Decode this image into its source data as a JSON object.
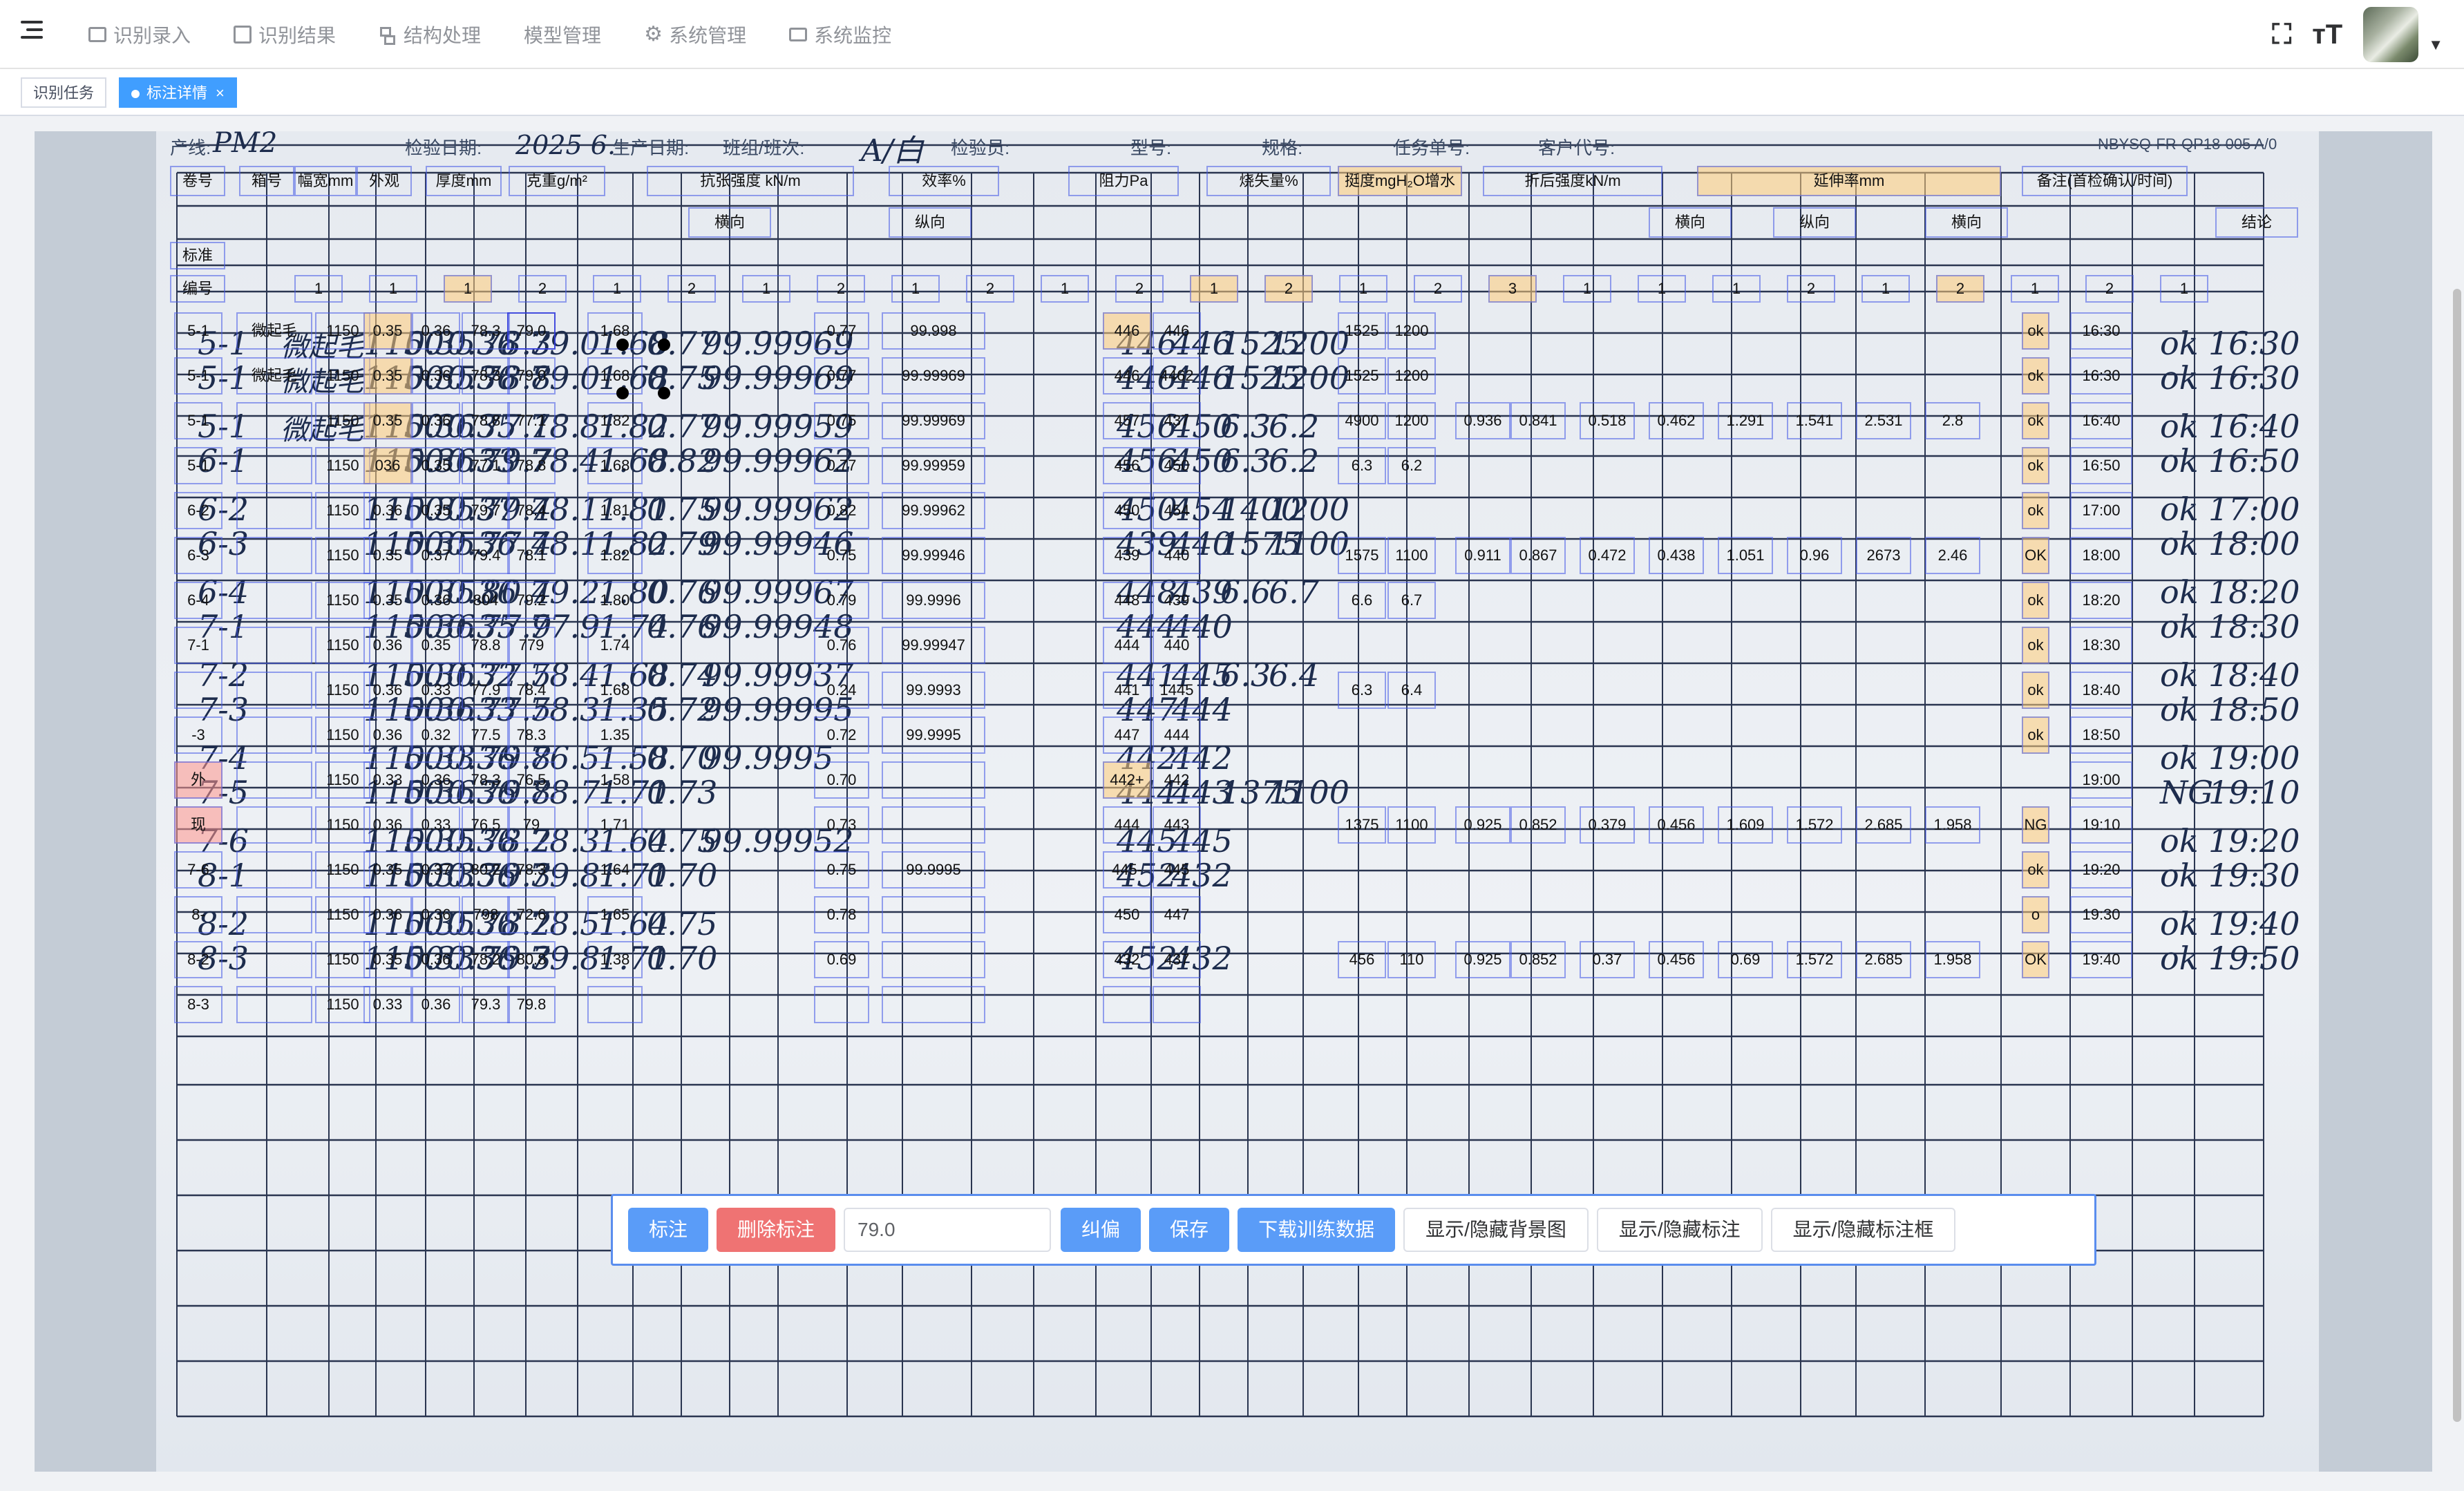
{
  "nav": {
    "menu": [
      {
        "label": "识别录入",
        "icon": "id-card-icon"
      },
      {
        "label": "识别结果",
        "icon": "edit-icon"
      },
      {
        "label": "结构处理",
        "icon": "tree-icon"
      },
      {
        "label": "模型管理",
        "icon": ""
      },
      {
        "label": "系统管理",
        "icon": "gear-icon"
      },
      {
        "label": "系统监控",
        "icon": "monitor-icon"
      }
    ]
  },
  "tags": {
    "task": "识别任务",
    "detail": "标注详情",
    "close": "×"
  },
  "document": {
    "header_fields": {
      "line_label": "产线:",
      "line_value": "PM2",
      "date_label": "检验日期:",
      "date_value": "2025 6.",
      "prod_date_label": "生产日期:",
      "shift_label": "班组/班次:",
      "shift_value": "A/白",
      "inspector_label": "检验员:",
      "model_label": "型号:",
      "spec_label": "规格:",
      "task_label": "任务单号:",
      "customer_label": "客户代号:",
      "doc_no": "NBYSQ-FR-QP18-005  A/0"
    },
    "header_cells": [
      "卷号",
      "箱号",
      "幅宽mm",
      "外观",
      "厚度mm",
      "克重g/m²",
      "抗张强度 kN/m",
      "效率%",
      "阻力Pa",
      "烧失量%",
      "挺度mgH₂O增水",
      "折后强度kN/m",
      "延伸率mm",
      "备注(首检确认/时间)"
    ],
    "sub_header_cells": [
      "横向",
      "纵向",
      "横向",
      "纵向",
      "横向",
      "结论"
    ],
    "std_label": "标准",
    "num_label": "编号",
    "num_row": [
      "1",
      "1",
      "1",
      "2",
      "1",
      "2",
      "1",
      "2",
      "1",
      "2",
      "1",
      "2",
      "1",
      "2",
      "1",
      "2",
      "3",
      "1",
      "1",
      "1",
      "2",
      "1",
      "2",
      "1",
      "2",
      "1",
      "2"
    ],
    "rows": [
      [
        "5-1",
        "微起毛",
        "1150",
        "0.35",
        "0.36",
        "78.3",
        "79.0",
        "1.68",
        "0.77",
        "99.998",
        "446",
        "446",
        "1525",
        "1200",
        "ok",
        "16:30"
      ],
      [
        "5-1",
        "微起毛",
        "1150",
        "0.35",
        "0.36",
        "78.3",
        "79.0",
        "1.68",
        "0.77",
        "99.99969",
        "446",
        "4462",
        "1525",
        "1200",
        "ok",
        "16:30"
      ],
      [
        "5-1",
        "",
        "1150",
        "0.35",
        "0.36",
        "78.8",
        "77.1",
        "1.82",
        "0.75",
        "99.99969",
        "457",
        "437",
        "4900",
        "1200",
        "0.936",
        "0.841",
        "0.518",
        "0.462",
        "1.291",
        "1.541",
        "2.531",
        "2.8",
        "ok",
        "16:40"
      ],
      [
        "5-1",
        "",
        "1150",
        "036",
        "0.35",
        "77.1",
        "78.8",
        "1.68",
        "0.77",
        "99.99959",
        "456",
        "450",
        "6.3",
        "6.2",
        "ok",
        "16:50"
      ],
      [
        "6-2",
        "",
        "1150",
        "0.36",
        "0.35",
        "79.7",
        "78.4",
        "1.81",
        "0.82",
        "99.99962",
        "450",
        "454",
        "ok",
        "17:00"
      ],
      [
        "6-3",
        "",
        "1150",
        "0.35",
        "0.37",
        "79.4",
        "78.1",
        "1.82",
        "0.75",
        "99.99946",
        "439",
        "440",
        "1575",
        "1100",
        "0.911",
        "0.867",
        "0.472",
        "0.438",
        "1.051",
        "0.96",
        "2673",
        "2.46",
        "OK",
        "18:00"
      ],
      [
        "6-4",
        "",
        "1150",
        "0.35",
        "0.36",
        "804",
        "79.2",
        "1.80",
        "0.79",
        "99.9996",
        "448",
        "439",
        "6.6",
        "6.7",
        "ok",
        "18:20"
      ],
      [
        "7-1",
        "",
        "1150",
        "0.36",
        "0.35",
        "78.8",
        "779",
        "1.74",
        "0.76",
        "99.99947",
        "444",
        "440",
        "ok",
        "18:30"
      ],
      [
        "",
        "",
        "1150",
        "0.36",
        "0.33",
        "77.9",
        "78.4",
        "1.68",
        "0.24",
        "99.9993",
        "441",
        "1445",
        "6.3",
        "6.4",
        "ok",
        "18:40"
      ],
      [
        "-3",
        "",
        "1150",
        "0.36",
        "0.32",
        "77.5",
        "78.3",
        "1.35",
        "0.72",
        "99.9995",
        "447",
        "444",
        "ok",
        "18:50"
      ],
      [
        "外",
        "",
        "1150",
        "0.33",
        "0.36",
        "78.3",
        "76.5",
        "1.58",
        "0.70",
        "",
        "442+",
        "442",
        "19:00"
      ],
      [
        "现",
        "",
        "1150",
        "0.36",
        "0.33",
        "76.5",
        "79",
        "1.71",
        "0.73",
        "",
        "444",
        "443",
        "1375",
        "1100",
        "0.925",
        "0.852",
        "0.379",
        "0.456",
        "1.609",
        "1.572",
        "2.685",
        "1.958",
        "NG",
        "19:10"
      ],
      [
        "7-6",
        "",
        "1150",
        "0.35",
        "0.37",
        "80.2",
        "78.3",
        "1.64",
        "0.75",
        "99.9995",
        "445-",
        "445",
        "ok",
        "19:20"
      ],
      [
        "8-",
        "",
        "1150",
        "0.36",
        "0.36",
        "798",
        "72.6",
        "1.65",
        "0.78",
        "",
        "450",
        "447",
        "o",
        "19:30"
      ],
      [
        "8-2",
        "",
        "1150",
        "0.35",
        "0.36",
        "78.2",
        "80.8",
        "1.38",
        "0.69",
        "",
        "432",
        "437",
        "456",
        "110",
        "0.925",
        "0.852",
        "0.37",
        "0.456",
        "0.69",
        "1.572",
        "2.685",
        "1.958",
        "OK",
        "19:40"
      ],
      [
        "8-3",
        "",
        "1150",
        "0.33",
        "0.36",
        "79.3",
        "79.8",
        "",
        "",
        "",
        "",
        ""
      ]
    ],
    "handwriting": {
      "hw_rows": [
        [
          "5-1",
          "微起毛",
          "1150",
          "0.35",
          "0.36",
          "78.3",
          "79.0",
          "1.68",
          "0.77",
          "99.99969",
          "446",
          "446",
          "1525",
          "1200",
          "ok",
          "16:30"
        ],
        [
          "5-1",
          "微起毛",
          "1150",
          "0.35",
          "0.36",
          "78.8",
          "79.0",
          "1.68",
          "0.75",
          "99.99969",
          "446",
          "446",
          "1525",
          "1200",
          "ok",
          "16:30"
        ],
        [
          "5-1",
          "微起毛",
          "1150",
          "0.36",
          "0.35",
          "77.1",
          "78.8",
          "1.82",
          "0.77",
          "99.99959",
          "456",
          "450",
          "6.3",
          "6.2",
          "ok",
          "16:40"
        ],
        [
          "6-1",
          "",
          "1150",
          "0.36",
          "0.33",
          "79.7",
          "78.4",
          "1.68",
          "0.82",
          "99.99962",
          "456",
          "450",
          "6.3",
          "6.2",
          "ok",
          "16:50"
        ],
        [
          "6-2",
          "",
          "1150",
          "0.35",
          "0.37",
          "79.4",
          "78.1",
          "1.81",
          "0.75",
          "99.99962",
          "450",
          "454",
          "1400",
          "1200",
          "ok",
          "17:00"
        ],
        [
          "6-3",
          "",
          "1150",
          "0.35",
          "0.36",
          "77.4",
          "78.1",
          "1.82",
          "0.79",
          "99.99946",
          "439",
          "440",
          "1575",
          "1100",
          "ok",
          "18:00"
        ],
        [
          "6-4",
          "",
          "1150",
          "0.35",
          "0.36",
          "80.4",
          "79.2",
          "1.80",
          "0.76",
          "99.99967",
          "448",
          "439",
          "6.6",
          "6.7",
          "ok",
          "18:20"
        ],
        [
          "7-1",
          "",
          "1150",
          "0.36",
          "0.35",
          "77.9",
          "77.9",
          "1.74",
          "0.76",
          "99.99948",
          "444",
          "440",
          "",
          "",
          "ok",
          "18:30"
        ],
        [
          "7-2",
          "",
          "1150",
          "0.36",
          "0.32",
          "77.5",
          "78.4",
          "1.68",
          "0.74",
          "99.99937",
          "441",
          "445",
          "6.3",
          "6.4",
          "ok",
          "18:40"
        ],
        [
          "7-3",
          "",
          "1150",
          "0.36",
          "0.33",
          "77.5",
          "78.3",
          "1.35",
          "0.72",
          "99.99995",
          "447",
          "444",
          "",
          "",
          "ok",
          "18:50"
        ],
        [
          "7-4",
          "",
          "1150",
          "0.33",
          "0.36",
          "79.8",
          "76.5",
          "1.58",
          "0.70",
          "99.9995",
          "442",
          "442",
          "",
          "",
          "ok",
          "19:00"
        ],
        [
          "7-5",
          "",
          "1150",
          "0.36",
          "0.36",
          "79.8",
          "78.7",
          "1.71",
          "0.73",
          "",
          "444",
          "443",
          "1375",
          "1100",
          "NG",
          "19:10"
        ],
        [
          "7-6",
          "",
          "1150",
          "0.35",
          "0.36",
          "78.2",
          "78.3",
          "1.64",
          "0.75",
          "99.99952",
          "445",
          "445",
          "",
          "",
          "ok",
          "19:20"
        ],
        [
          "8-1",
          "",
          "1150",
          "0.33",
          "0.36",
          "79.3",
          "79.8",
          "1.71",
          "0.70",
          "",
          "452",
          "432",
          "",
          "",
          "ok",
          "19:30"
        ],
        [
          "8-2",
          "",
          "1150",
          "0.35",
          "0.36",
          "78.2",
          "78.5",
          "1.64",
          "0.75",
          "",
          "",
          "",
          "",
          "",
          "ok",
          "19:40"
        ],
        [
          "8-3",
          "",
          "1150",
          "0.33",
          "0.36",
          "79.3",
          "79.8",
          "1.71",
          "0.70",
          "",
          "452",
          "432",
          "",
          "",
          "ok",
          "19:50"
        ]
      ]
    }
  },
  "toolbar": {
    "annotate": "标注",
    "delete": "删除标注",
    "value": "79.0",
    "correct": "纠偏",
    "save": "保存",
    "download": "下载训练数据",
    "toggle_bg": "显示/隐藏背景图",
    "toggle_annot": "显示/隐藏标注",
    "toggle_box": "显示/隐藏标注框"
  }
}
